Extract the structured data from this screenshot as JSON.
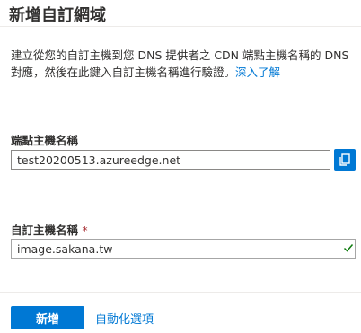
{
  "header": {
    "title": "新增自訂網域"
  },
  "description": {
    "text": "建立從您的自訂主機到您 DNS 提供者之 CDN 端點主機名稱的 DNS 對應，然後在此鍵入自訂主機名稱進行驗證。",
    "link": "深入了解"
  },
  "endpoint_hostname": {
    "label": "端點主機名稱",
    "value": "test20200513.azureedge.net",
    "copy_icon": "copy-icon"
  },
  "custom_hostname": {
    "label": "自訂主機名稱",
    "required_mark": "*",
    "value": "image.sakana.tw",
    "valid_icon": "checkmark-icon"
  },
  "footer": {
    "add_button": "新增",
    "automation_link": "自動化選項"
  },
  "colors": {
    "accent": "#0078d4",
    "valid": "#107c10",
    "required": "#a4262c"
  }
}
